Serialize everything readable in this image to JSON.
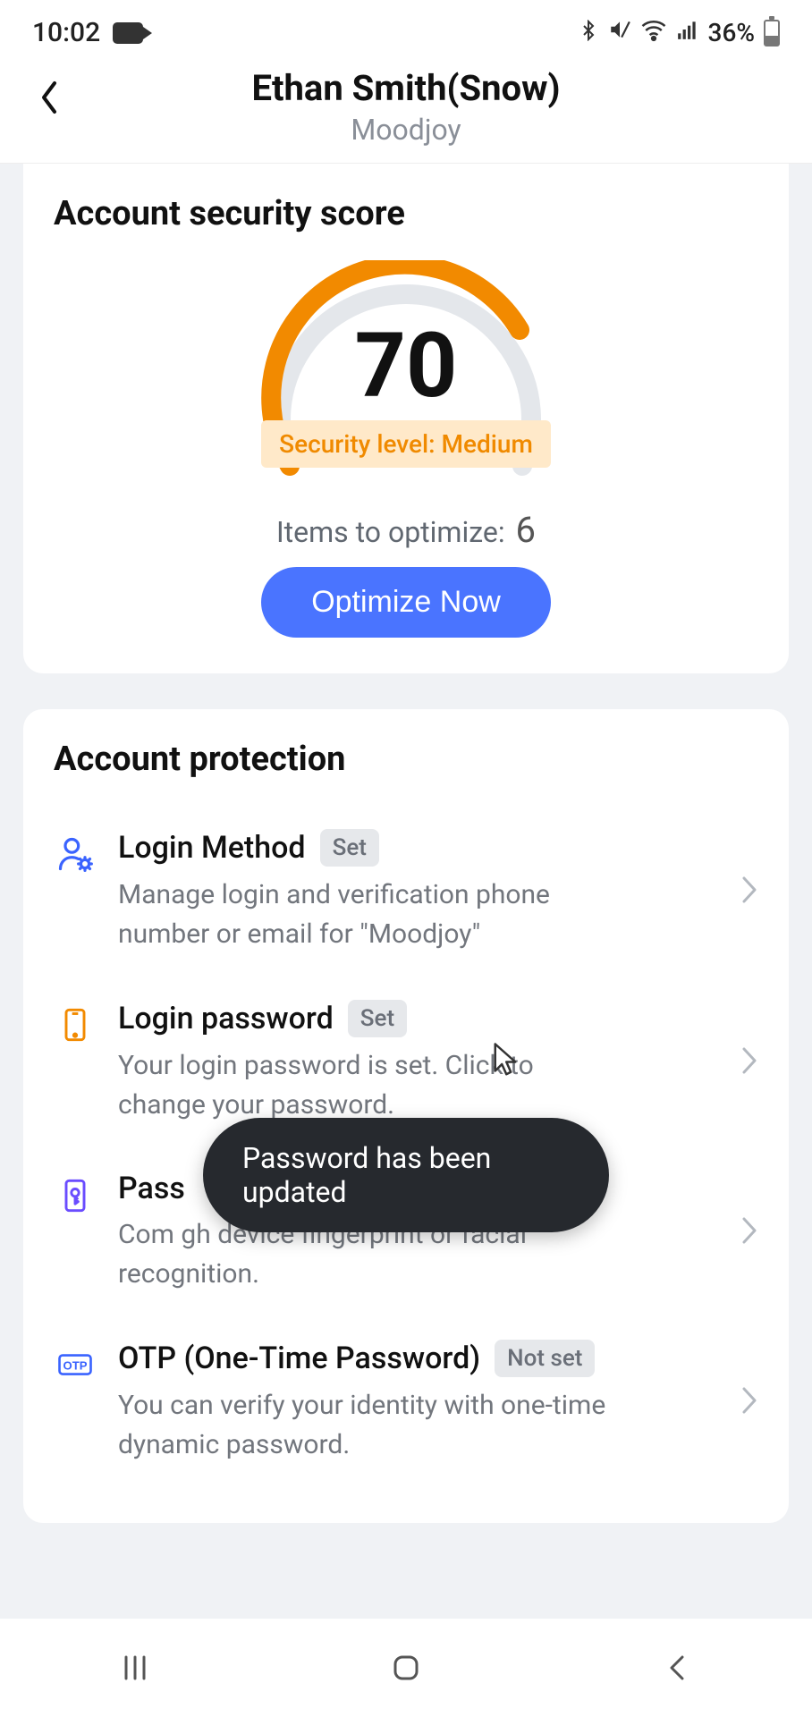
{
  "statusbar": {
    "time": "10:02",
    "battery_pct": "36%"
  },
  "header": {
    "title": "Ethan Smith(Snow)",
    "subtitle": "Moodjoy"
  },
  "security_score": {
    "section_title": "Account security score",
    "score": "70",
    "level_label": "Security level: Medium",
    "items_label": "Items to optimize:",
    "items_count": "6",
    "optimize_button": "Optimize Now",
    "gauge_pct": 70,
    "accent_color": "#f28a00"
  },
  "protection": {
    "section_title": "Account protection",
    "items": [
      {
        "title": "Login Method",
        "badge": "Set",
        "desc": "Manage login and verification phone number or email for \"Moodjoy\"",
        "icon": "user-gear-icon",
        "icon_color": "#3a63ff"
      },
      {
        "title": "Login password",
        "badge": "Set",
        "desc": "Your login password is set. Click to change your password.",
        "icon": "phone-icon",
        "icon_color": "#f28a00"
      },
      {
        "title": "Pass",
        "badge": "",
        "desc": "Com                                                         gh device fingerprint or facial recognition.",
        "icon": "key-phone-icon",
        "icon_color": "#6a4cff"
      },
      {
        "title": "OTP (One-Time Password)",
        "badge": "Not set",
        "desc": "You can verify your identity with one-time dynamic password.",
        "icon": "otp-icon",
        "icon_color": "#3a63ff"
      }
    ]
  },
  "toast": {
    "text": "Password has been updated"
  }
}
